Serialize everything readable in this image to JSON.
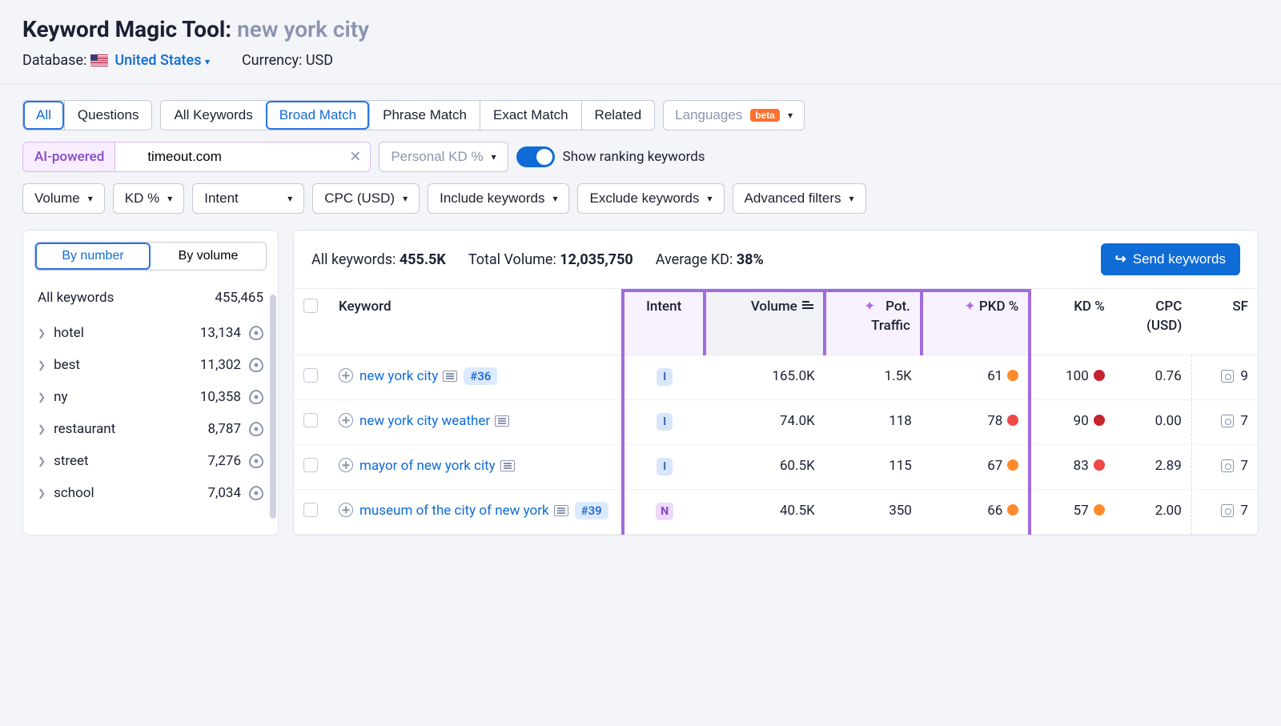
{
  "header": {
    "title_prefix": "Keyword Magic Tool:",
    "query": "new york city",
    "database_label": "Database:",
    "country": "United States",
    "currency_label": "Currency: USD"
  },
  "tabs1": {
    "all": "All",
    "questions": "Questions"
  },
  "tabs2": {
    "all_kw": "All Keywords",
    "broad": "Broad Match",
    "phrase": "Phrase Match",
    "exact": "Exact Match",
    "related": "Related"
  },
  "languages": {
    "label": "Languages",
    "beta": "beta"
  },
  "ai": {
    "pill": "AI-powered",
    "domain": "timeout.com"
  },
  "personal_kd": "Personal KD %",
  "toggle_label": "Show ranking keywords",
  "filters": {
    "volume": "Volume",
    "kd": "KD %",
    "intent": "Intent",
    "cpc": "CPC (USD)",
    "include": "Include keywords",
    "exclude": "Exclude keywords",
    "advanced": "Advanced filters"
  },
  "left": {
    "by_number": "By number",
    "by_volume": "By volume",
    "all_label": "All keywords",
    "all_count": "455,465",
    "items": [
      {
        "label": "hotel",
        "count": "13,134"
      },
      {
        "label": "best",
        "count": "11,302"
      },
      {
        "label": "ny",
        "count": "10,358"
      },
      {
        "label": "restaurant",
        "count": "8,787"
      },
      {
        "label": "street",
        "count": "7,276"
      },
      {
        "label": "school",
        "count": "7,034"
      }
    ]
  },
  "stats": {
    "all_kw_label": "All keywords:",
    "all_kw_value": "455.5K",
    "tv_label": "Total Volume:",
    "tv_value": "12,035,750",
    "akd_label": "Average KD:",
    "akd_value": "38%",
    "send_btn": "Send keywords"
  },
  "columns": {
    "keyword": "Keyword",
    "intent": "Intent",
    "volume": "Volume",
    "pot_traffic_1": "Pot.",
    "pot_traffic_2": "Traffic",
    "pkd": "PKD %",
    "kd": "KD %",
    "cpc": "CPC (USD)",
    "sf": "SF"
  },
  "rows": [
    {
      "keyword": "new york city",
      "rank": "#36",
      "intent": "I",
      "volume": "165.0K",
      "pot": "1.5K",
      "pkd": "61",
      "pkd_c": "orange",
      "kd": "100",
      "kd_c": "darkred",
      "cpc": "0.76",
      "sf": "9"
    },
    {
      "keyword": "new york city weather",
      "rank": "",
      "intent": "I",
      "volume": "74.0K",
      "pot": "118",
      "pkd": "78",
      "pkd_c": "red",
      "kd": "90",
      "kd_c": "darkred",
      "cpc": "0.00",
      "sf": "7"
    },
    {
      "keyword": "mayor of new york city",
      "rank": "",
      "intent": "I",
      "volume": "60.5K",
      "pot": "115",
      "pkd": "67",
      "pkd_c": "orange",
      "kd": "83",
      "kd_c": "red",
      "cpc": "2.89",
      "sf": "7"
    },
    {
      "keyword": "museum of the city of new york",
      "rank": "#39",
      "intent": "N",
      "volume": "40.5K",
      "pot": "350",
      "pkd": "66",
      "pkd_c": "orange",
      "kd": "57",
      "kd_c": "orange",
      "cpc": "2.00",
      "sf": "7"
    }
  ]
}
